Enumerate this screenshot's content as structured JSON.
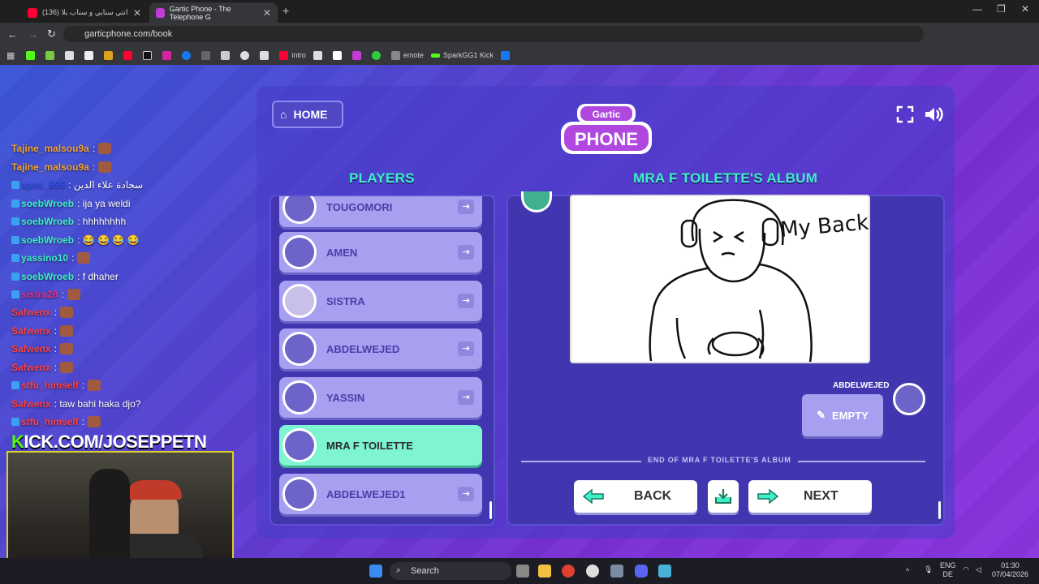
{
  "browser": {
    "tabs": [
      {
        "label": "(136) انتي سنابي و سناب بلا",
        "active": false,
        "color": "#ff0033"
      },
      {
        "label": "Gartic Phone - The Telephone G",
        "active": true,
        "color": "#c33bd8"
      }
    ],
    "url": "garticphone.com/book",
    "bookmarks": [
      "intro",
      "emote",
      "SparkGG1 Kick"
    ]
  },
  "game": {
    "home_label": "HOME",
    "players_title": "PLAYERS",
    "album_title": "MRA F TOILETTE'S ALBUM",
    "players": [
      {
        "name": "TOUGOMORI",
        "active": false
      },
      {
        "name": "AMEN",
        "active": false
      },
      {
        "name": "SISTRA",
        "active": false
      },
      {
        "name": "ABDELWEJED",
        "active": false
      },
      {
        "name": "YASSIN",
        "active": false
      },
      {
        "name": "MRA F TOILETTE",
        "active": true
      },
      {
        "name": "ABDELWEJED1",
        "active": false
      }
    ],
    "drawing_text": "My Back!",
    "answer_author": "ABDELWEJED",
    "answer_label": "EMPTY",
    "end_text": "END OF MRA F TOILETTE'S ALBUM",
    "back_label": "BACK",
    "next_label": "NEXT",
    "accent": "#3ef0c6"
  },
  "chat": {
    "messages": [
      {
        "user": "Tajine_malsou9a",
        "text": ":",
        "color": "#f0a030"
      },
      {
        "user": "Tajine_malsou9a",
        "text": ":",
        "color": "#f0a030"
      },
      {
        "user": "apex_999",
        "text": ": سجادة علاء الدين",
        "color": "#3050f0"
      },
      {
        "user": "soebWroeb",
        "text": ": ija ya weldi",
        "color": "#3ef0c6"
      },
      {
        "user": "soebWroeb",
        "text": ": hhhhhhhh",
        "color": "#3ef0c6"
      },
      {
        "user": "soebWroeb",
        "text": ": 😂 😂 😂 😂",
        "color": "#3ef0c6"
      },
      {
        "user": "yassino10",
        "text": ":",
        "color": "#3ef0c6"
      },
      {
        "user": "soebWroeb",
        "text": ": f dhaher",
        "color": "#3ef0c6"
      },
      {
        "user": "sistra28",
        "text": ":",
        "color": "#e03080"
      },
      {
        "user": "Safwenx",
        "text": ":",
        "color": "#ff4040"
      },
      {
        "user": "Safwenx",
        "text": ":",
        "color": "#ff4040"
      },
      {
        "user": "Safwenx",
        "text": ":",
        "color": "#ff4040"
      },
      {
        "user": "Safwenx",
        "text": ":",
        "color": "#ff4040"
      },
      {
        "user": "stfu_himself",
        "text": ":",
        "color": "#ff4040"
      },
      {
        "user": "Safwenx",
        "text": ": taw bahi haka djo?",
        "color": "#ff4040"
      },
      {
        "user": "stfu_himself",
        "text": ":",
        "color": "#ff4040"
      }
    ],
    "kick_prefix": "K",
    "kick_rest": "ICK.COM/JOSEPPETN"
  },
  "taskbar": {
    "search": "Search",
    "lang_top": "ENG",
    "lang_bottom": "DE",
    "time": "01:30",
    "date": "07/04/2026"
  }
}
